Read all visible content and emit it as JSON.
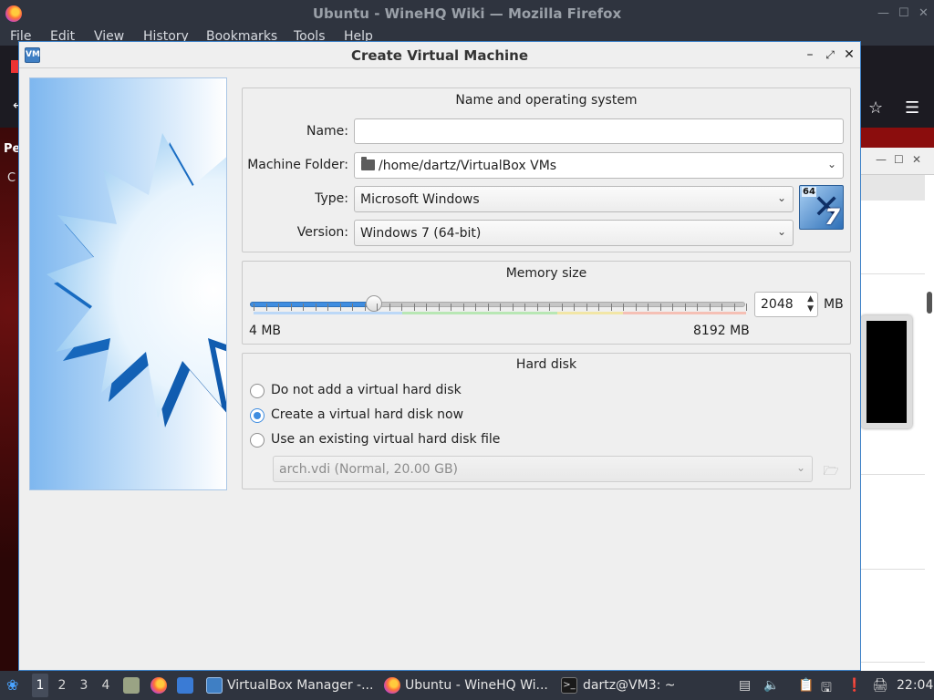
{
  "firefox": {
    "title": "Ubuntu - WineHQ Wiki — Mozilla Firefox",
    "menu": [
      "File",
      "Edit",
      "View",
      "History",
      "Bookmarks",
      "Tools",
      "Help"
    ],
    "left_peek": {
      "a": "Pe",
      "b": "C"
    }
  },
  "dialog": {
    "title": "Create Virtual Machine",
    "name_os": {
      "title": "Name and operating system",
      "name_label": "Name:",
      "name_value": "",
      "folder_label": "Machine Folder:",
      "folder_value": "/home/dartz/VirtualBox VMs",
      "type_label": "Type:",
      "type_value": "Microsoft Windows",
      "version_label": "Version:",
      "version_value": "Windows 7 (64-bit)",
      "badge_bits": "64",
      "badge_version": "7"
    },
    "memory": {
      "title": "Memory size",
      "min_label": "4 MB",
      "max_label": "8192 MB",
      "value": "2048",
      "unit": "MB",
      "min": 4,
      "max": 8192,
      "current": 2048
    },
    "hard_disk": {
      "title": "Hard disk",
      "options": [
        {
          "label": "Do not add a virtual hard disk",
          "checked": false
        },
        {
          "label": "Create a virtual hard disk now",
          "checked": true
        },
        {
          "label": "Use an existing virtual hard disk file",
          "checked": false
        }
      ],
      "existing_file": "arch.vdi (Normal, 20.00 GB)"
    }
  },
  "taskbar": {
    "workspaces": [
      "1",
      "2",
      "3",
      "4"
    ],
    "active_workspace": "1",
    "tasks": [
      {
        "label": "VirtualBox Manager -..."
      },
      {
        "label": "Ubuntu - WineHQ Wi..."
      },
      {
        "label": "dartz@VM3: ~"
      }
    ],
    "clock": "22:04"
  },
  "colors": {
    "accent": "#3f8de0",
    "panel": "#2f343f",
    "dialog_bg": "#efefef"
  }
}
